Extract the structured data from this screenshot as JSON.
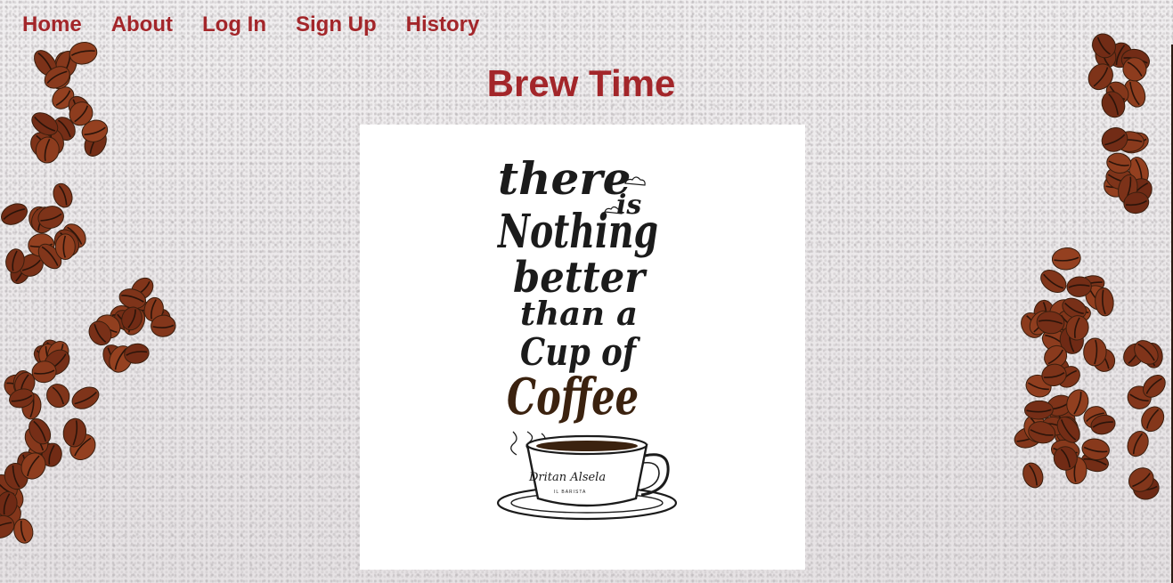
{
  "nav": {
    "items": [
      {
        "label": "Home"
      },
      {
        "label": "About"
      },
      {
        "label": "Log In"
      },
      {
        "label": "Sign Up"
      },
      {
        "label": "History"
      }
    ]
  },
  "header": {
    "title": "Brew Time"
  },
  "poster": {
    "lines": [
      "there",
      "is",
      "Nothing",
      "better",
      "than a",
      "Cup of",
      "Coffee"
    ],
    "cup_signature": "Dritan Alsela",
    "cup_subtitle": "IL BARISTA"
  },
  "colors": {
    "accent": "#a3262a",
    "ink": "#1b1b1b",
    "coffee": "#3b220f"
  }
}
